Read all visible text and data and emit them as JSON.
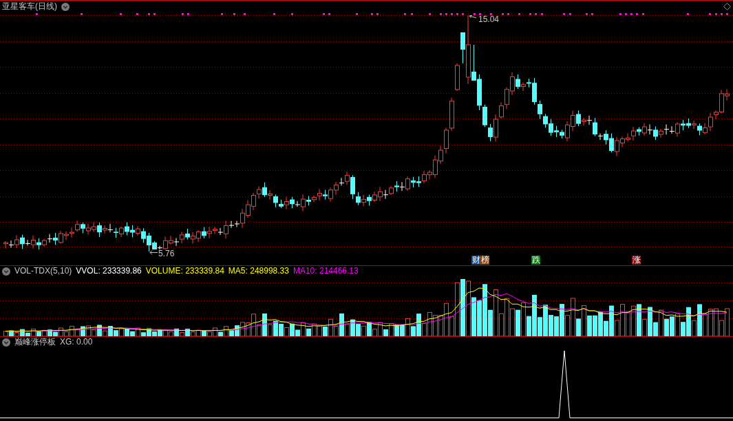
{
  "price_panel": {
    "title": "亚星客车(日线)",
    "high_label": "15.04",
    "low_label": "5.76",
    "event_badges": [
      {
        "text": "财",
        "color": "#1c4f8a"
      },
      {
        "text": "榜",
        "color": "#8a4a14"
      },
      {
        "text": "跌",
        "color": "#0c7a12"
      },
      {
        "text": "涨",
        "color": "#8c1010"
      }
    ]
  },
  "volume_panel": {
    "indicator": "VOL-TDX(5,10)",
    "readings": [
      {
        "text": "VVOL: 233339.86",
        "color": "#ffffff"
      },
      {
        "text": "VOLUME: 233339.84",
        "color": "#ffff00"
      },
      {
        "text": "MA5: 248998.33",
        "color": "#ffff00"
      },
      {
        "text": "MA10: 214466.13",
        "color": "#ff00ff"
      }
    ]
  },
  "signal_panel": {
    "indicator": "巅峰涨停板",
    "reading": "XG: 0.00"
  }
}
